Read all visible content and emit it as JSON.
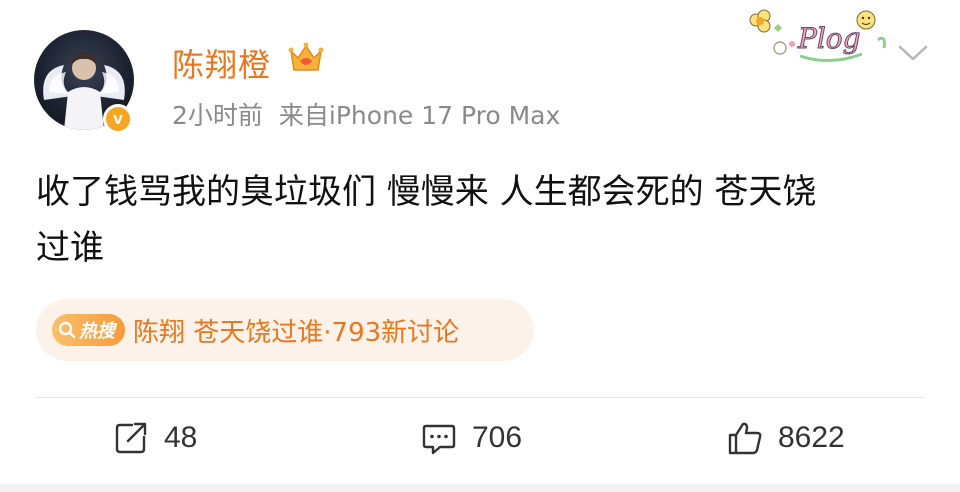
{
  "post": {
    "username": "陈翔橙",
    "time": "2小时前",
    "source": "来自iPhone 17 Pro Max",
    "sticker_text": "Plog",
    "content_line1": "收了钱骂我的臭垃圾们 慢慢来 人生都会死的 苍天饶",
    "content_line2": "过谁",
    "verified_mark": "v"
  },
  "hot_search": {
    "tag": "热搜",
    "text": "陈翔 苍天饶过谁·793新讨论"
  },
  "actions": {
    "repost_count": "48",
    "comment_count": "706",
    "like_count": "8622"
  },
  "colors": {
    "username": "#e9771d",
    "meta": "#8a8a8a",
    "chip_bg": "#fdf2e9",
    "hot_tag": "#f49b3c",
    "verified": "#f6a623"
  },
  "icons": [
    "crown-icon",
    "plog-sticker",
    "chevron-down-icon",
    "search-icon",
    "repost-icon",
    "comment-icon",
    "like-icon"
  ]
}
